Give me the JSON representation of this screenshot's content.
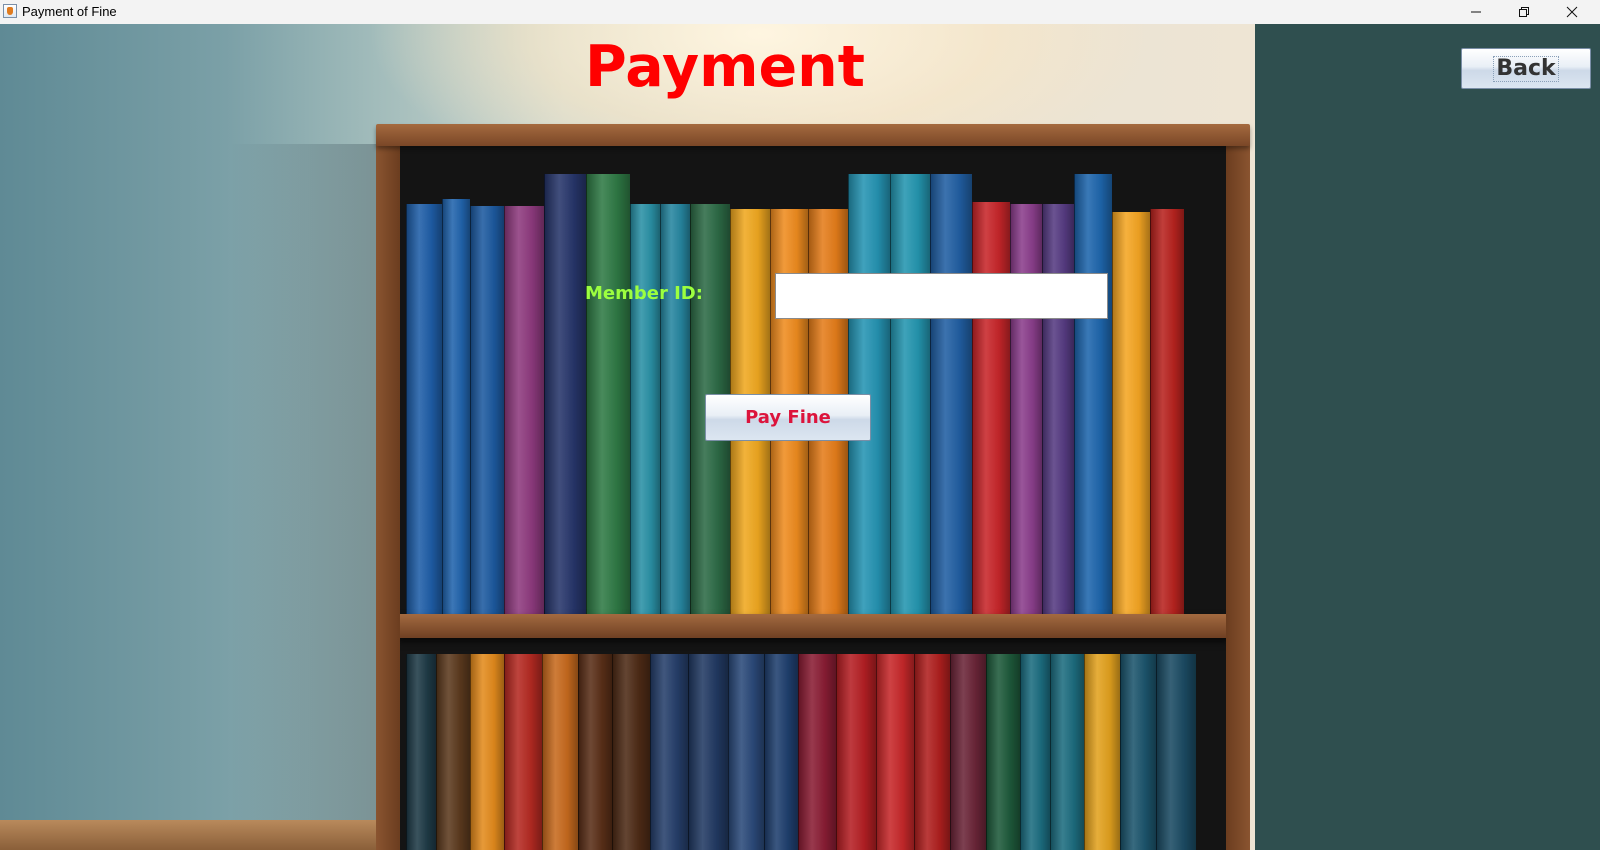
{
  "window": {
    "title": "Payment of Fine",
    "controls": [
      "minimize",
      "restore",
      "close"
    ]
  },
  "page": {
    "title": "Payment",
    "member_label": "Member ID:",
    "member_input_value": "",
    "pay_button_label": "Pay Fine",
    "back_button_label": "Back"
  },
  "colors": {
    "title": "#ff0000",
    "member_label": "#9cff3f",
    "pay_button_text": "#dc143c",
    "right_panel": "#2f4f4f"
  },
  "icons": {
    "app": "java-app-icon",
    "minimize": "minimize-icon",
    "restore": "restore-icon",
    "close": "close-icon"
  }
}
